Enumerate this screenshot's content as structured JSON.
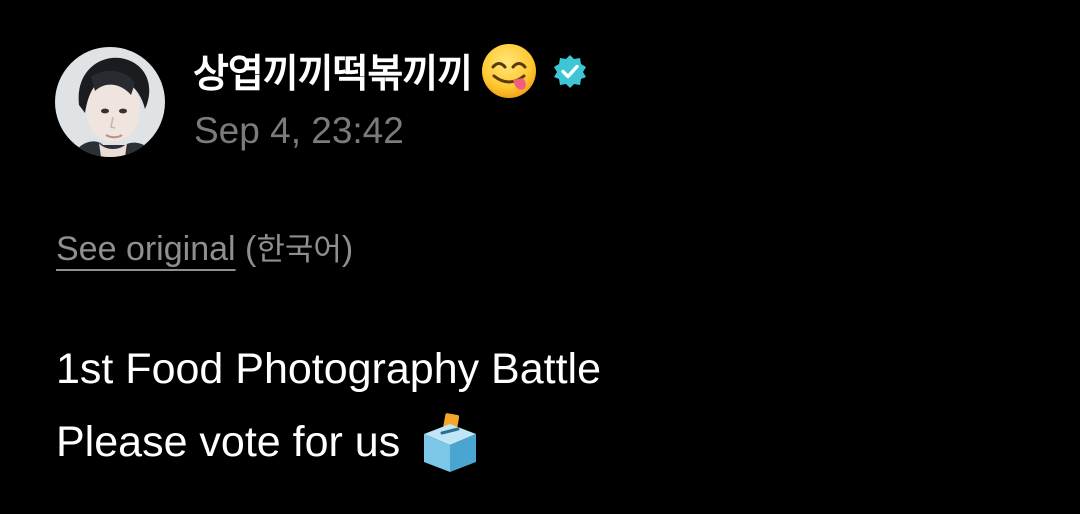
{
  "author": {
    "display_name": "상엽끼끼떡볶끼끼",
    "name_emoji": "face-savoring-food-icon",
    "verified": true,
    "avatar": "avatar"
  },
  "post": {
    "timestamp": "Sep 4, 23:42",
    "translation": {
      "see_original_label": "See original",
      "language_open": "(",
      "language": "한국어",
      "language_close": ")"
    },
    "lines": [
      "1st Food Photography Battle",
      "Please vote for us"
    ],
    "trailing_emoji": "ballot-box-icon"
  },
  "colors": {
    "background": "#000000",
    "primary_text": "#ffffff",
    "secondary_text": "#7b7b7b",
    "link_text": "#8f8f8f",
    "verified_badge": "#3ec6d6"
  }
}
